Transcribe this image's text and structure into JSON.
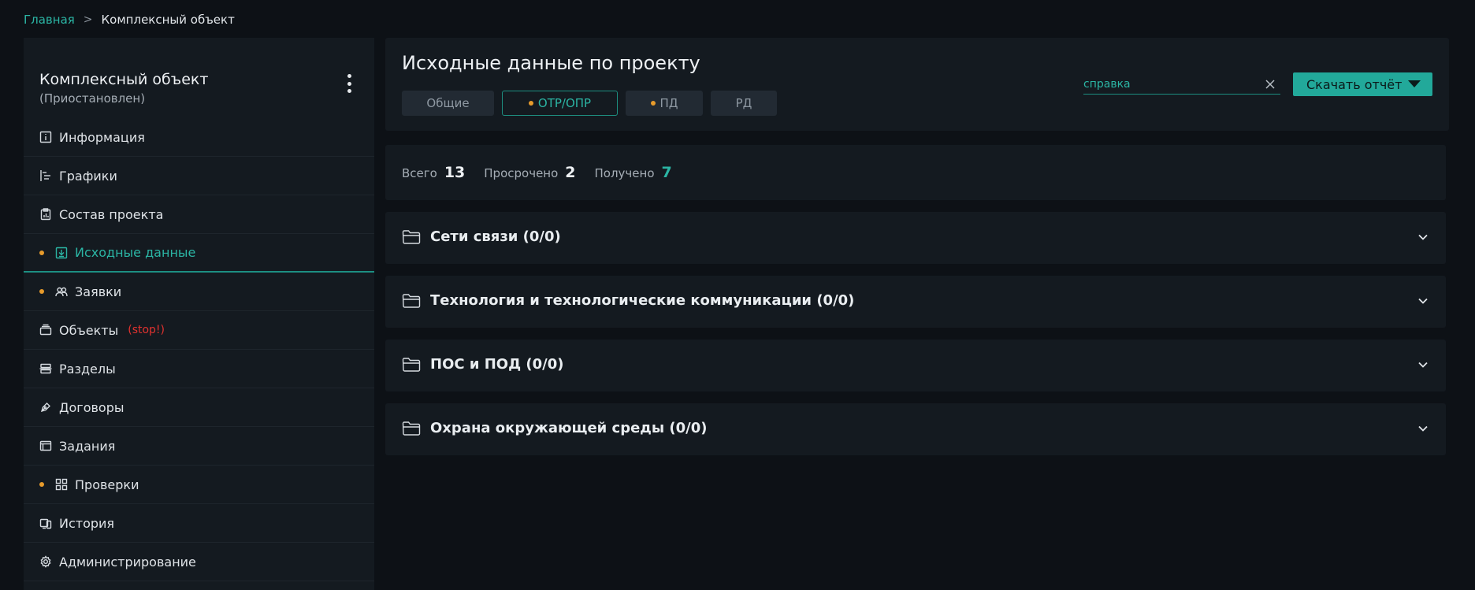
{
  "breadcrumb": {
    "home": "Главная",
    "separator": ">",
    "current": "Комплексный объект"
  },
  "sidebar": {
    "title": "Комплексный объект",
    "status": "(Приостановлен)",
    "menu_icon": "kebab-vertical-icon",
    "items": [
      {
        "label": "Информация",
        "icon": "info-icon",
        "dot": false,
        "active": false
      },
      {
        "label": "Графики",
        "icon": "gantt-icon",
        "dot": false,
        "active": false
      },
      {
        "label": "Состав проекта",
        "icon": "clipboard-chart-icon",
        "dot": false,
        "active": false
      },
      {
        "label": "Исходные данные",
        "icon": "download-box-icon",
        "dot": true,
        "active": true
      },
      {
        "label": "Заявки",
        "icon": "users-icon",
        "dot": true,
        "active": false
      },
      {
        "label": "Объекты",
        "icon": "stack-box-icon",
        "dot": false,
        "active": false,
        "tag": "(stop!)"
      },
      {
        "label": "Разделы",
        "icon": "layers-icon",
        "dot": false,
        "active": false
      },
      {
        "label": "Договоры",
        "icon": "pen-icon",
        "dot": false,
        "active": false
      },
      {
        "label": "Задания",
        "icon": "window-icon",
        "dot": false,
        "active": false
      },
      {
        "label": "Проверки",
        "icon": "grid-check-icon",
        "dot": true,
        "active": false
      },
      {
        "label": "История",
        "icon": "devices-icon",
        "dot": false,
        "active": false
      },
      {
        "label": "Администрирование",
        "icon": "gear-icon",
        "dot": false,
        "active": false
      }
    ]
  },
  "header": {
    "title": "Исходные данные по проекту",
    "tabs": [
      {
        "label": "Общие",
        "dot": false,
        "active": false
      },
      {
        "label": "ОТР/ОПР",
        "dot": true,
        "active": true
      },
      {
        "label": "ПД",
        "dot": true,
        "active": false
      },
      {
        "label": "РД",
        "dot": false,
        "active": false
      }
    ],
    "search": {
      "value": "справка",
      "clear_icon": "close-icon"
    },
    "download_label": "Скачать отчёт",
    "download_icon": "caret-down-icon"
  },
  "stats": {
    "total_label": "Всего",
    "total_value": "13",
    "overdue_label": "Просрочено",
    "overdue_value": "2",
    "received_label": "Получено",
    "received_value": "7"
  },
  "sections": [
    {
      "title": "Сети связи (0/0)",
      "icon": "folder-icon"
    },
    {
      "title": "Технология и технологические коммуникации (0/0)",
      "icon": "folder-icon"
    },
    {
      "title": "ПОС и ПОД (0/0)",
      "icon": "folder-icon"
    },
    {
      "title": "Охрана окружающей среды (0/0)",
      "icon": "folder-icon"
    }
  ],
  "colors": {
    "accent": "#2bb5a4",
    "button": "#22a99a",
    "dot": "#e79b2b",
    "danger": "#e0322f",
    "background": "#0d1116",
    "panel": "#141a20"
  }
}
